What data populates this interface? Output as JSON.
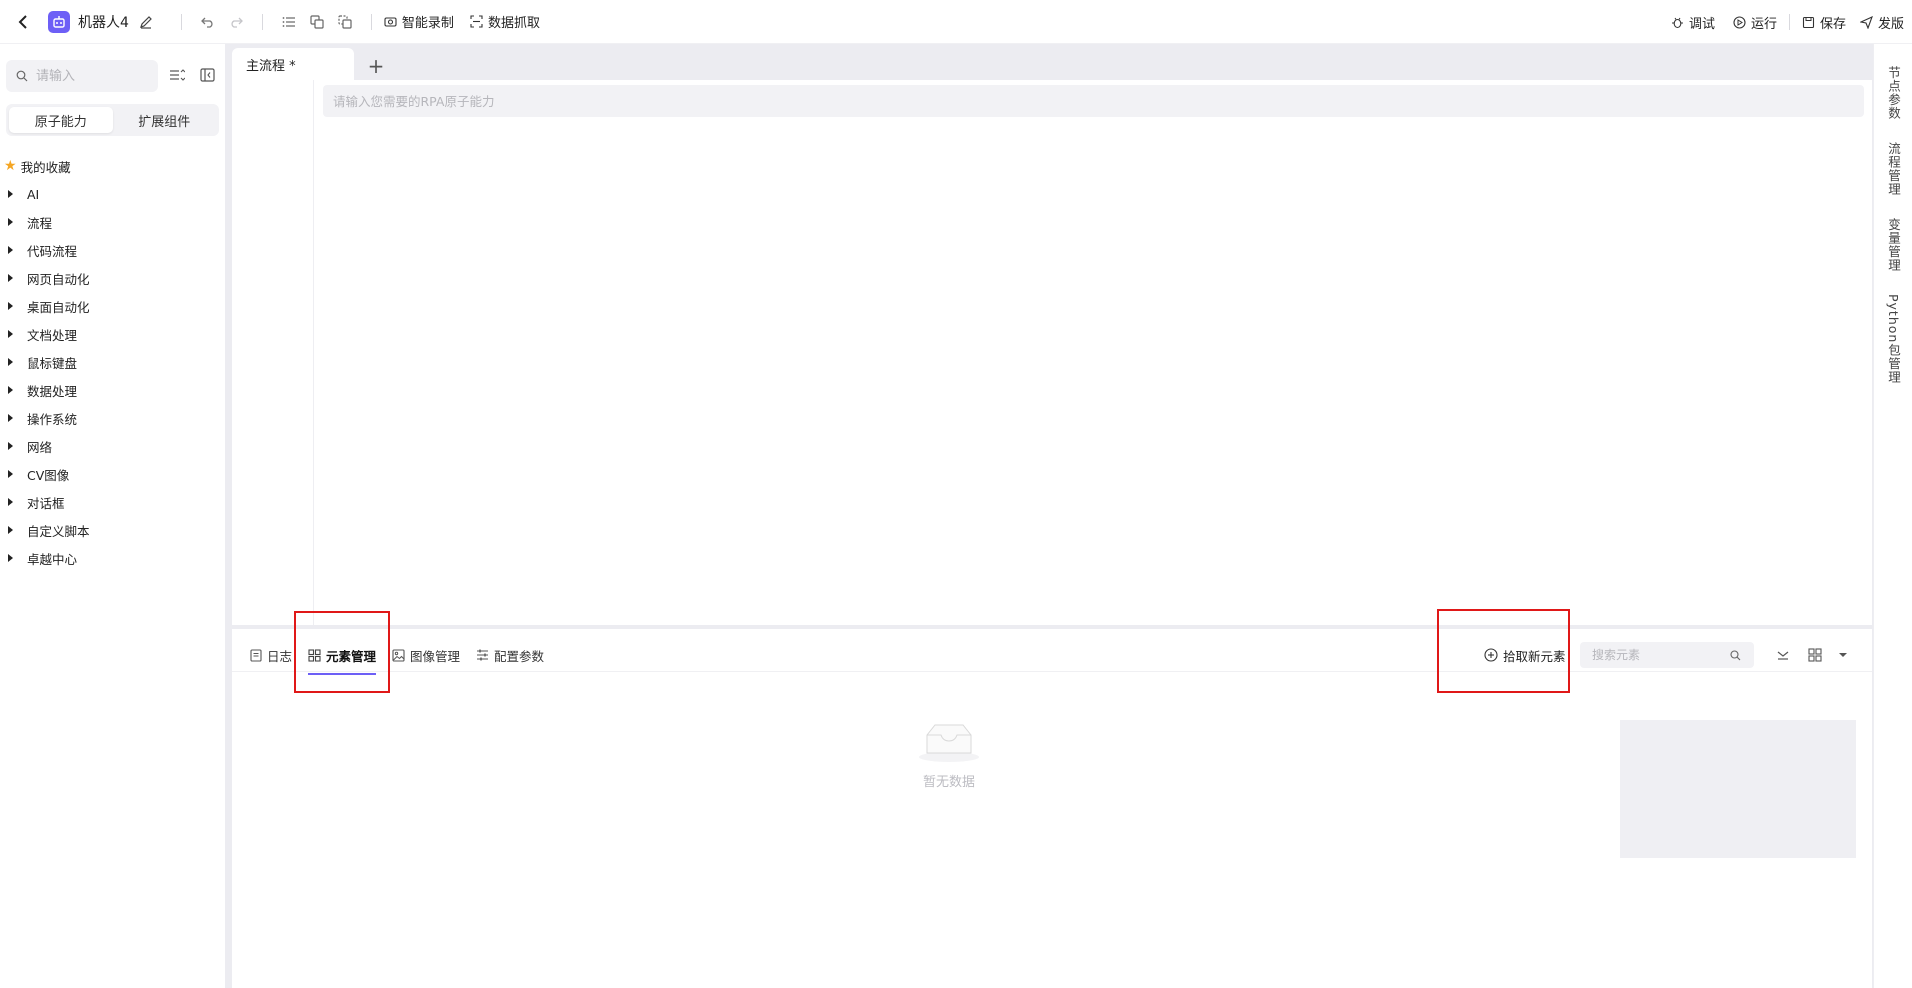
{
  "header": {
    "robot_name": "机器人4",
    "actions_left": {
      "record": "智能录制",
      "scrape": "数据抓取"
    },
    "actions_right": {
      "debug": "调试",
      "run": "运行",
      "save": "保存",
      "publish": "发版"
    }
  },
  "sidebar": {
    "search_placeholder": "请输入",
    "segments": [
      "原子能力",
      "扩展组件"
    ],
    "active_segment": "原子能力",
    "favorites_label": "我的收藏",
    "items": [
      {
        "label": "AI"
      },
      {
        "label": "流程"
      },
      {
        "label": "代码流程"
      },
      {
        "label": "网页自动化"
      },
      {
        "label": "桌面自动化"
      },
      {
        "label": "文档处理"
      },
      {
        "label": "鼠标键盘"
      },
      {
        "label": "数据处理"
      },
      {
        "label": "操作系统"
      },
      {
        "label": "网络"
      },
      {
        "label": "CV图像"
      },
      {
        "label": "对话框"
      },
      {
        "label": "自定义脚本"
      },
      {
        "label": "卓越中心"
      }
    ]
  },
  "editor": {
    "tab_label": "主流程 *",
    "add_tab_symbol": "+",
    "atom_search_placeholder": "请输入您需要的RPA原子能力"
  },
  "bottom_panel": {
    "tabs": [
      {
        "label": "日志",
        "icon": "log-icon"
      },
      {
        "label": "元素管理",
        "icon": "grid-icon",
        "active": true
      },
      {
        "label": "图像管理",
        "icon": "image-icon"
      },
      {
        "label": "配置参数",
        "icon": "sliders-icon"
      }
    ],
    "pick_element_label": "拾取新元素",
    "search_placeholder": "搜索元素",
    "empty_text": "暂无数据"
  },
  "right_rail": {
    "items": [
      "节点参数",
      "流程管理",
      "变量管理",
      "Python包管理"
    ]
  },
  "colors": {
    "accent": "#6d5ff6",
    "highlight": "#e01818",
    "star": "#f5a623"
  }
}
